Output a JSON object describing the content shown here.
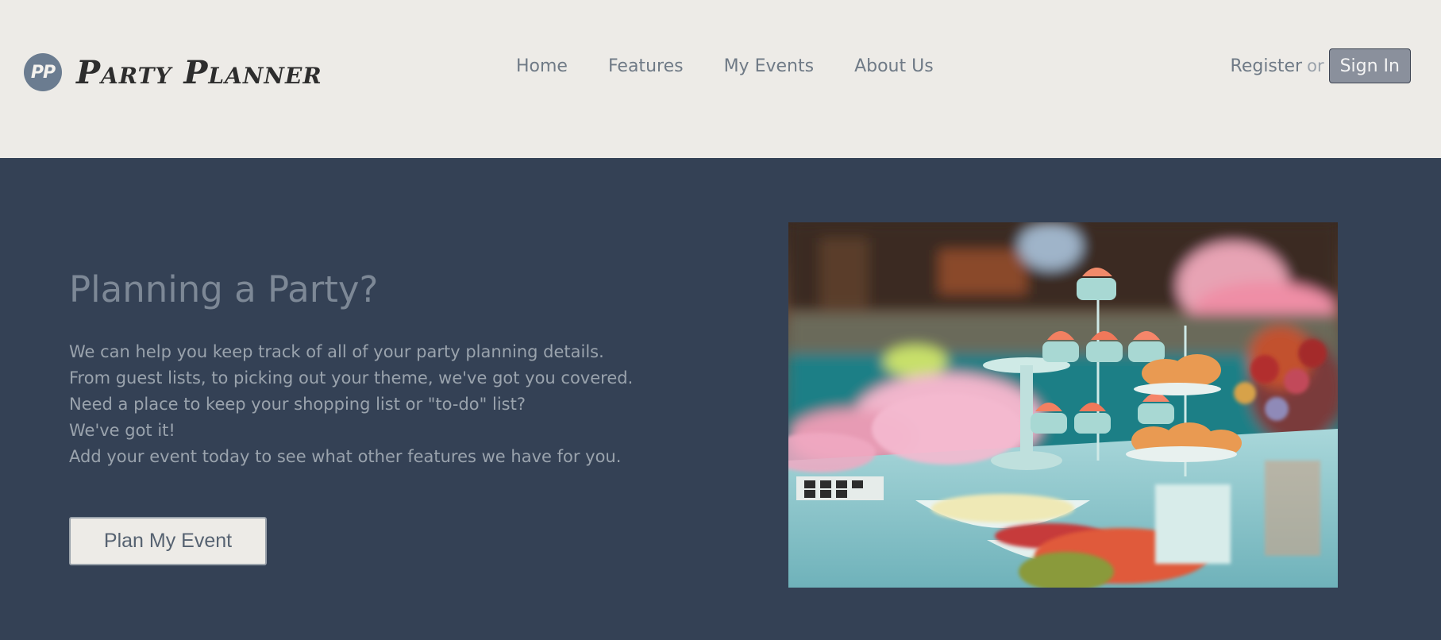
{
  "brand": {
    "badge": "PP",
    "name": "Party Planner"
  },
  "nav": {
    "items": [
      "Home",
      "Features",
      "My Events",
      "About Us"
    ]
  },
  "auth": {
    "register": "Register",
    "or": "or",
    "sign_in": "Sign In"
  },
  "hero": {
    "title": "Planning a Party?",
    "lines": [
      "We can help you keep track of all of your party planning details.",
      "From guest lists, to picking out your theme, we've got you covered.",
      "Need a place to keep your shopping list or \"to-do\" list?",
      "We've got it!",
      "Add your event today to see what other features we have for you."
    ],
    "cta": "Plan My Event"
  },
  "colors": {
    "header_bg": "#edebe7",
    "hero_bg": "#344155",
    "nav_text": "#6f7a86",
    "sign_in_bg": "#8a909c"
  }
}
